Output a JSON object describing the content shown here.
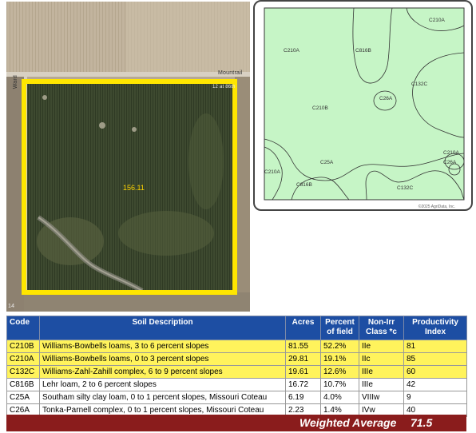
{
  "aerial": {
    "road_name": "Mountrail",
    "road_side_label": "Ward",
    "road_top_right": "12 at 86th",
    "corner_label": "14",
    "field_acres": "156.11",
    "colors": {
      "field_outline": "#ffe600",
      "acres_text": "#ffd400"
    }
  },
  "soil_map": {
    "labels": [
      "C210A",
      "C210A",
      "C816B",
      "C210B",
      "C26A",
      "C132C",
      "C210A",
      "C26A",
      "C210A",
      "C25A",
      "C816B",
      "C132C"
    ],
    "credit": "©2025 AgriData, Inc.",
    "colors": {
      "fill": "#c6f5c6",
      "line": "#333333"
    }
  },
  "table": {
    "headers": {
      "code": "Code",
      "description": "Soil Description",
      "acres": "Acres",
      "percent": "Percent of field",
      "class": "Non-Irr Class *c",
      "index": "Productivity Index"
    },
    "rows": [
      {
        "code": "C210B",
        "description": "Williams-Bowbells loams, 3 to 6 percent slopes",
        "acres": "81.55",
        "percent": "52.2%",
        "class": "IIe",
        "index": "81",
        "highlight": true
      },
      {
        "code": "C210A",
        "description": "Williams-Bowbells loams, 0 to 3 percent slopes",
        "acres": "29.81",
        "percent": "19.1%",
        "class": "IIc",
        "index": "85",
        "highlight": true
      },
      {
        "code": "C132C",
        "description": "Williams-Zahl-Zahill complex, 6 to 9 percent slopes",
        "acres": "19.61",
        "percent": "12.6%",
        "class": "IIIe",
        "index": "60",
        "highlight": true
      },
      {
        "code": "C816B",
        "description": "Lehr loam, 2 to 6 percent slopes",
        "acres": "16.72",
        "percent": "10.7%",
        "class": "IIIe",
        "index": "42",
        "highlight": false
      },
      {
        "code": "C25A",
        "description": "Southam silty clay loam, 0 to 1 percent slopes, Missouri Coteau",
        "acres": "6.19",
        "percent": "4.0%",
        "class": "VIIIw",
        "index": "9",
        "highlight": false
      },
      {
        "code": "C26A",
        "description": "Tonka-Parnell complex, 0 to 1 percent slopes, Missouri Coteau",
        "acres": "2.23",
        "percent": "1.4%",
        "class": "IVw",
        "index": "40",
        "highlight": false
      }
    ],
    "weighted_average_label": "Weighted Average",
    "weighted_average_value": "71.5",
    "colors": {
      "header_bg": "#1d4ea3",
      "highlight_bg": "#fff35c",
      "footer_bg": "#8a1c1c"
    }
  }
}
